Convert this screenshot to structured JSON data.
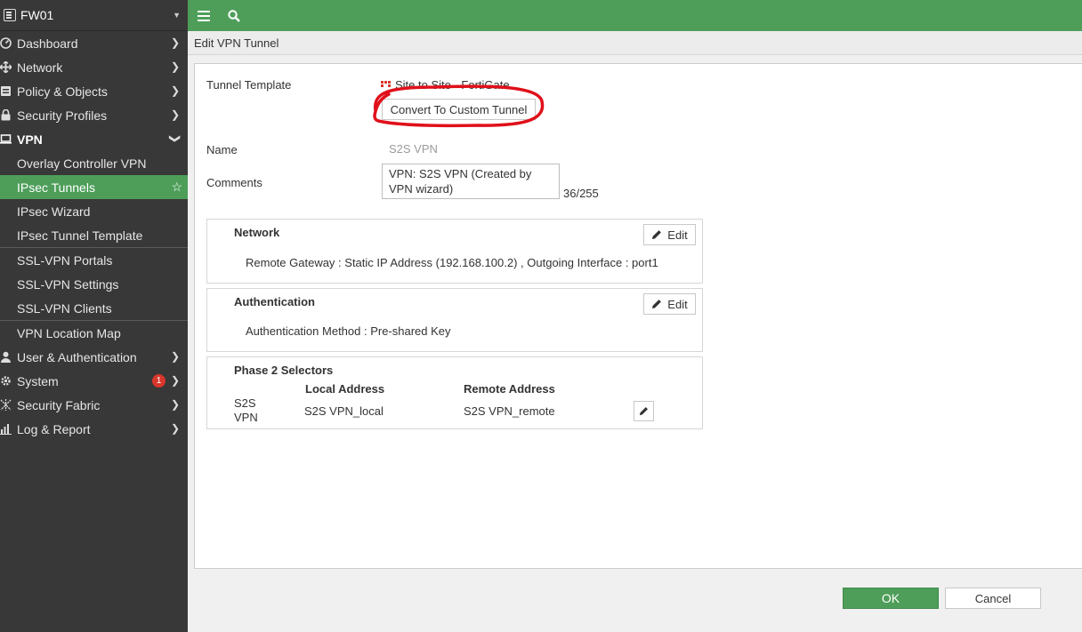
{
  "device": {
    "name": "FW01"
  },
  "sidebar": {
    "items": [
      {
        "label": "Dashboard"
      },
      {
        "label": "Network"
      },
      {
        "label": "Policy & Objects"
      },
      {
        "label": "Security Profiles"
      },
      {
        "label": "VPN"
      },
      {
        "label": "Overlay Controller VPN"
      },
      {
        "label": "IPsec Tunnels"
      },
      {
        "label": "IPsec Wizard"
      },
      {
        "label": "IPsec Tunnel Template"
      },
      {
        "label": "SSL-VPN Portals"
      },
      {
        "label": "SSL-VPN Settings"
      },
      {
        "label": "SSL-VPN Clients"
      },
      {
        "label": "VPN Location Map"
      },
      {
        "label": "User & Authentication"
      },
      {
        "label": "System"
      },
      {
        "label": "Security Fabric"
      },
      {
        "label": "Log & Report"
      }
    ],
    "system_badge": "1"
  },
  "page": {
    "title": "Edit VPN Tunnel"
  },
  "form": {
    "tunnel_template_label": "Tunnel Template",
    "tunnel_template_value": "Site to Site - FortiGate",
    "convert_button": "Convert To Custom Tunnel",
    "name_label": "Name",
    "name_value": "S2S VPN",
    "comments_label": "Comments",
    "comments_value": "VPN: S2S VPN (Created by VPN wizard)",
    "comments_counter": "36/255"
  },
  "network_card": {
    "title": "Network",
    "edit": "Edit",
    "detail": "Remote Gateway : Static IP Address (192.168.100.2) , Outgoing Interface : port1"
  },
  "auth_card": {
    "title": "Authentication",
    "edit": "Edit",
    "detail": "Authentication Method : Pre-shared Key"
  },
  "phase2": {
    "title": "Phase 2 Selectors",
    "col_local": "Local Address",
    "col_remote": "Remote Address",
    "row_name_1": "S2S",
    "row_name_2": "VPN",
    "local": "S2S VPN_local",
    "remote": "S2S VPN_remote"
  },
  "footer": {
    "ok": "OK",
    "cancel": "Cancel"
  },
  "colors": {
    "accent": "#4e9e5a",
    "sidebar": "#383838",
    "annotation": "#e0101a"
  }
}
